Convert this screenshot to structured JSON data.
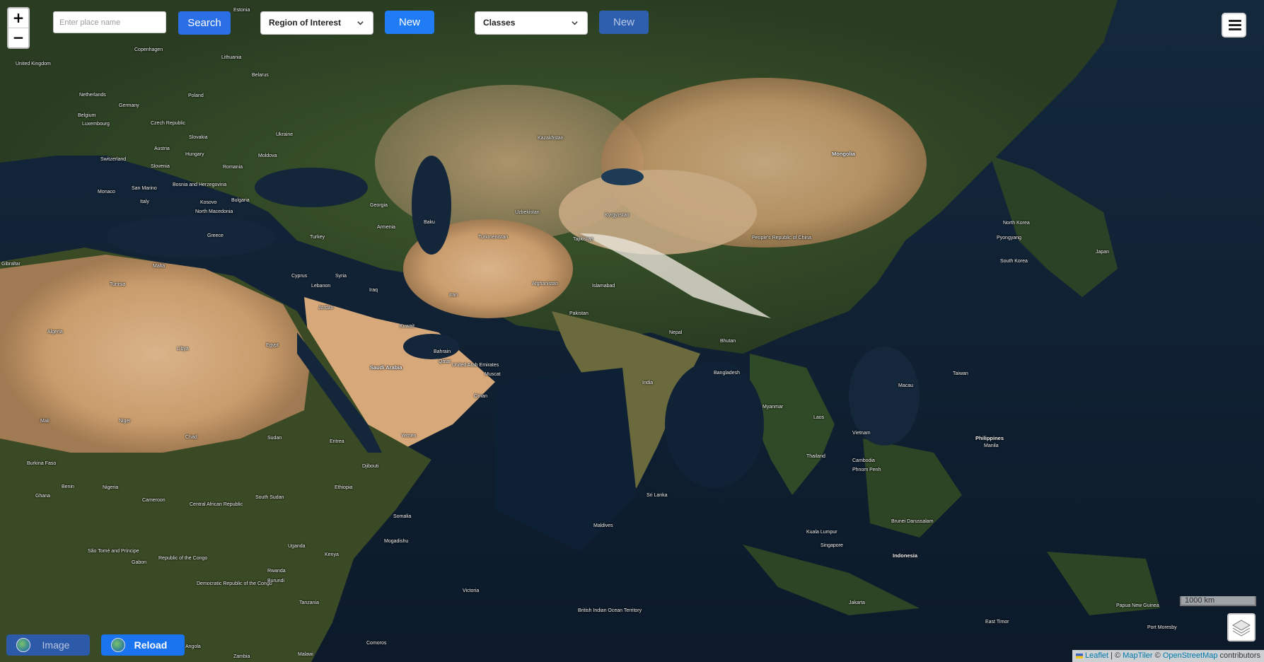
{
  "search": {
    "placeholder": "Enter place name",
    "button_label": "Search"
  },
  "region_select": {
    "selected": "Region of Interest"
  },
  "new_button_1": "New",
  "classes_select": {
    "selected": "Classes"
  },
  "new_button_2": "New",
  "zoom": {
    "in": "+",
    "out": "−"
  },
  "scale_label": "1000 km",
  "attribution": {
    "leaflet": "Leaflet",
    "sep1": " | © ",
    "maptiler": "MapTiler",
    "sep2": " © ",
    "osm": "OpenStreetMap",
    "tail": " contributors"
  },
  "bottom": {
    "image_label": "Image",
    "reload_label": "Reload"
  },
  "map_labels": [
    "Estonia",
    "Lithuania",
    "Belarus",
    "Poland",
    "Germany",
    "Netherlands",
    "Belgium",
    "Luxembourg",
    "Czech Republic",
    "Slovakia",
    "Austria",
    "Hungary",
    "Switzerland",
    "Slovenia",
    "Moldova",
    "Ukraine",
    "Romania",
    "Bosnia and Herzegovina",
    "Monaco",
    "San Marino",
    "Italy",
    "Kosovo",
    "Bulgaria",
    "North Macedonia",
    "Greece",
    "Malta",
    "Tunisia",
    "Algeria",
    "Libya",
    "Egypt",
    "Gibraltar",
    "Turkey",
    "Georgia",
    "Armenia",
    "Syria",
    "Lebanon",
    "Cyprus",
    "Jordan",
    "Iraq",
    "Kuwait",
    "Saudi Arabia",
    "Bahrain",
    "Qatar",
    "United Arab Emirates",
    "Oman",
    "Muscat",
    "Yemen",
    "Eritrea",
    "Djibouti",
    "Ethiopia",
    "Somalia",
    "Sudan",
    "South Sudan",
    "Chad",
    "Niger",
    "Mali",
    "Burkina Faso",
    "Nigeria",
    "Ghana",
    "Benin",
    "Cameroon",
    "Central African Republic",
    "Republic of the Congo",
    "Democratic Republic of the Congo",
    "Gabon",
    "São Tomé and Príncipe",
    "Uganda",
    "Kenya",
    "Rwanda",
    "Burundi",
    "Tanzania",
    "Zambia",
    "Angola",
    "Malawi",
    "Comoros",
    "Mogadishu",
    "Victoria",
    "Iran",
    "Turkmenistan",
    "Uzbekistan",
    "Kazakhstan",
    "Kyrgyzstan",
    "Tajikistan",
    "Afghanistan",
    "Islamabad",
    "Pakistan",
    "India",
    "Nepal",
    "Bhutan",
    "Bangladesh",
    "Sri Lanka",
    "Maldives",
    "British Indian Ocean Territory",
    "Mongolia",
    "People's Republic of China",
    "North Korea",
    "Pyongyang",
    "South Korea",
    "Japan",
    "Taiwan",
    "Macau",
    "Myanmar",
    "Laos",
    "Thailand",
    "Vietnam",
    "Cambodia",
    "Phnom Penh",
    "Philippines",
    "Manila",
    "Kuala Lumpur",
    "Singapore",
    "Brunei Darussalam",
    "Indonesia",
    "Jakarta",
    "East Timor",
    "Papua New Guinea",
    "Port Moresby",
    "Baku",
    "United Kingdom",
    "Copenhagen"
  ]
}
